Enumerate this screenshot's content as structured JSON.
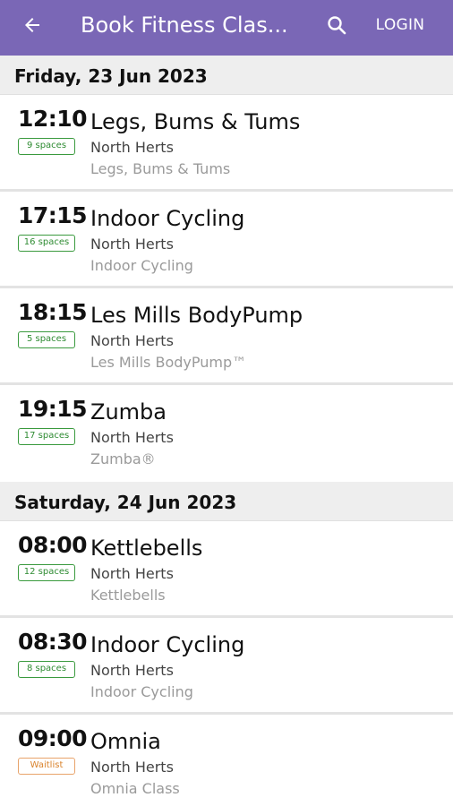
{
  "appbar": {
    "title": "Book Fitness Clas...",
    "login_label": "LOGIN",
    "back_icon": "arrow-left-icon",
    "search_icon": "search-icon",
    "color": "#7a67b6"
  },
  "days": [
    {
      "date": "Friday, 23 Jun 2023",
      "classes": [
        {
          "time": "12:10",
          "spaces": "9 spaces",
          "name": "Legs, Bums & Tums",
          "location": "North Herts",
          "subtitle": "Legs, Bums & Tums"
        },
        {
          "time": "17:15",
          "spaces": "16 spaces",
          "name": "Indoor Cycling",
          "location": "North Herts",
          "subtitle": "Indoor Cycling"
        },
        {
          "time": "18:15",
          "spaces": "5 spaces",
          "name": "Les Mills BodyPump",
          "location": "North Herts",
          "subtitle": "Les Mills BodyPump™"
        },
        {
          "time": "19:15",
          "spaces": "17 spaces",
          "name": "Zumba",
          "location": "North Herts",
          "subtitle": "Zumba®"
        }
      ]
    },
    {
      "date": "Saturday, 24 Jun 2023",
      "classes": [
        {
          "time": "08:00",
          "spaces": "12 spaces",
          "name": "Kettlebells",
          "location": "North Herts",
          "subtitle": "Kettlebells"
        },
        {
          "time": "08:30",
          "spaces": "8 spaces",
          "name": "Indoor Cycling",
          "location": "North Herts",
          "subtitle": "Indoor Cycling"
        },
        {
          "time": "09:00",
          "spaces": "Waitlist",
          "name": "Omnia",
          "location": "North Herts",
          "subtitle": "Omnia Class"
        }
      ]
    }
  ],
  "colors": {
    "badge_available": "#2e8b32",
    "badge_waitlist": "#d9822b"
  }
}
